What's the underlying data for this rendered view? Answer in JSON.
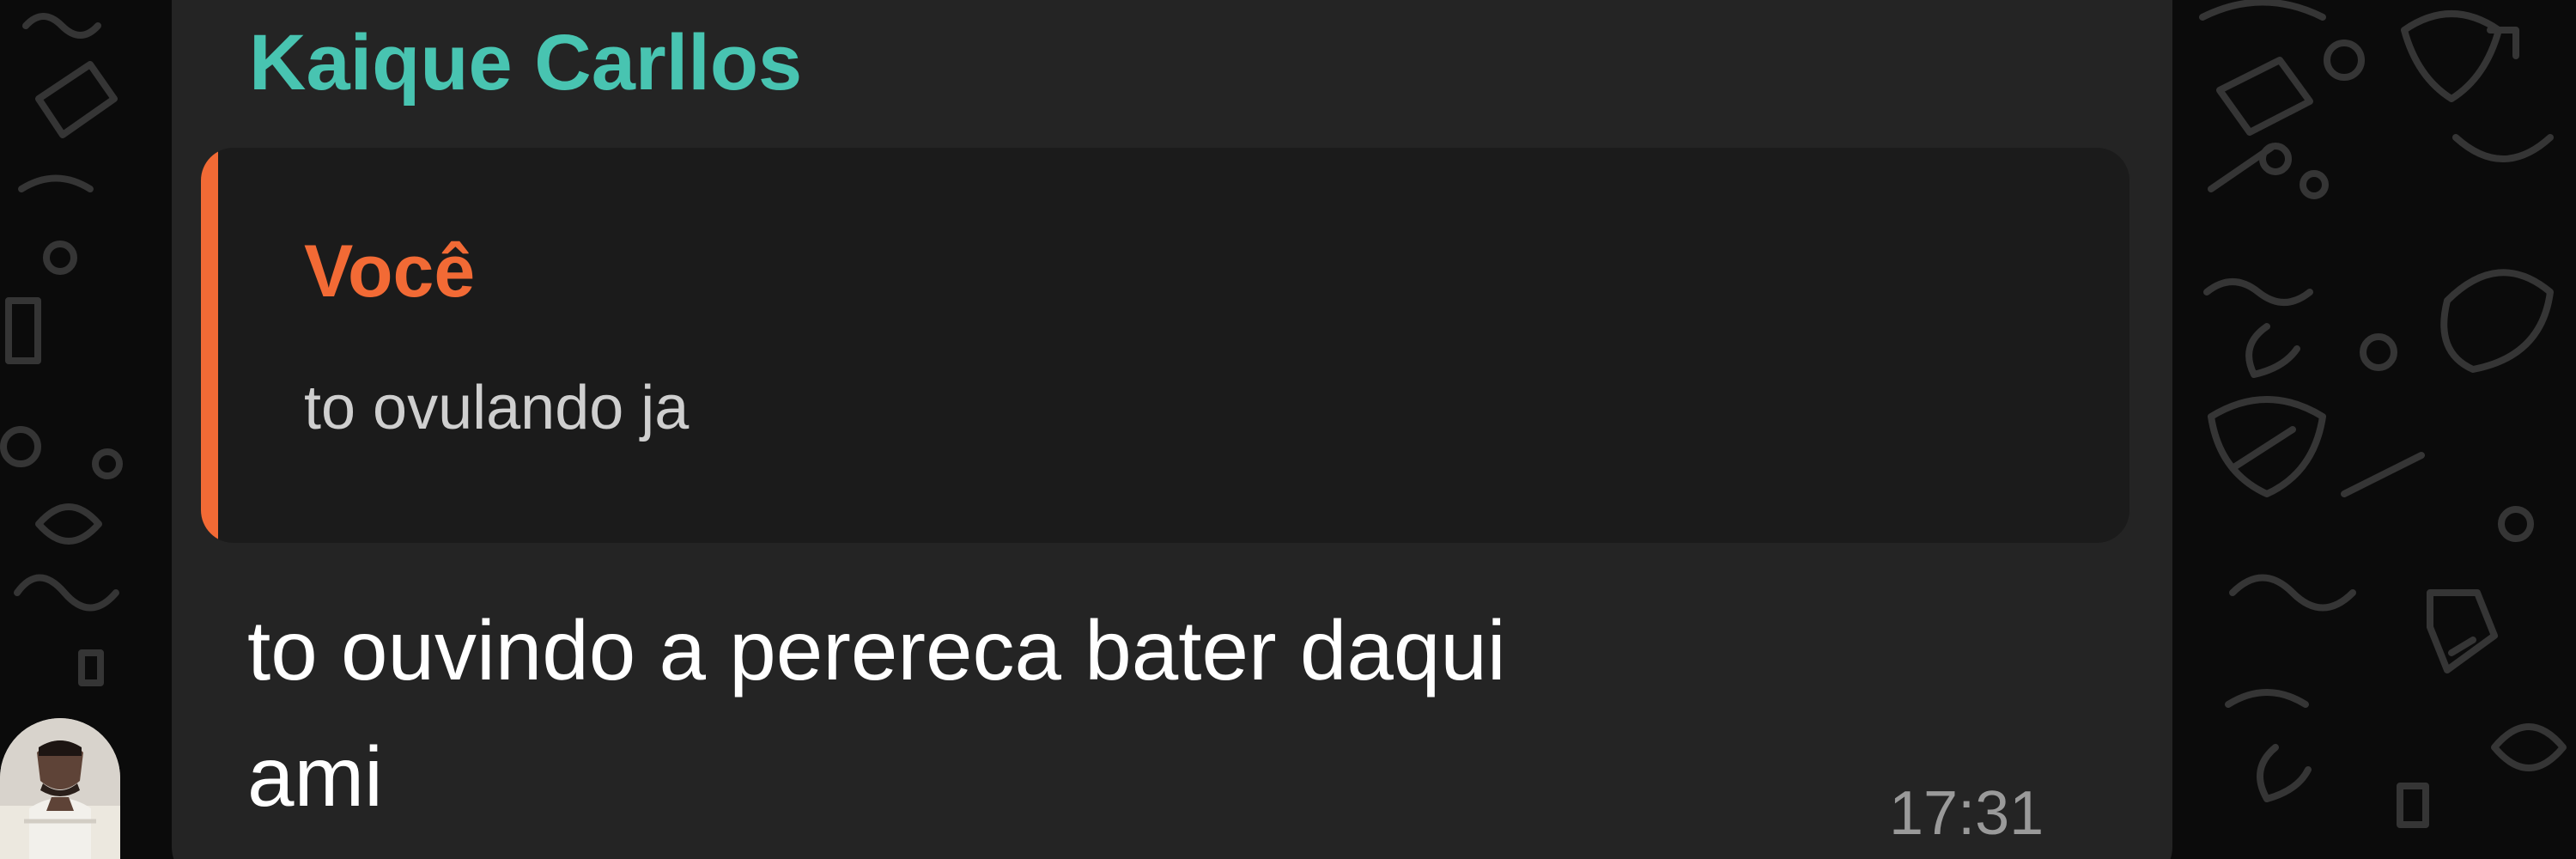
{
  "message": {
    "sender_name": "Kaique Carllos",
    "quoted": {
      "author": "Você",
      "text": "to ovulando ja"
    },
    "text": "to ouvindo a perereca bater daqui\nami",
    "time": "17:31"
  },
  "avatar": {
    "icon": "contact-avatar-photo"
  },
  "colors": {
    "background": "#0b0b0b",
    "bubble": "#242424",
    "quote_background": "#1b1b1b",
    "sender_name": "#48c4b1",
    "quote_accent": "#f26a35",
    "message_text": "#ffffff",
    "quoted_text": "#cfcfcf",
    "timestamp": "#9a9a9a"
  }
}
